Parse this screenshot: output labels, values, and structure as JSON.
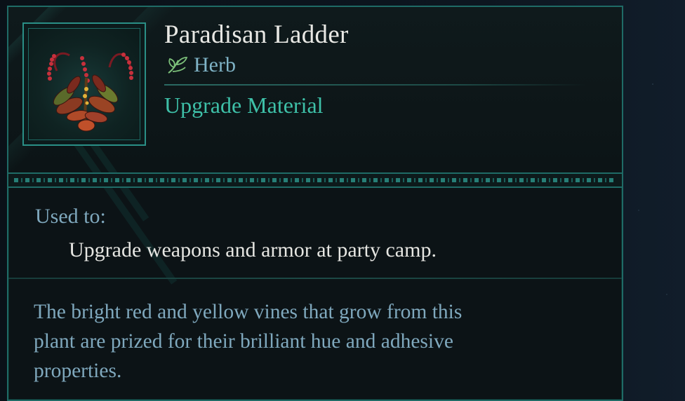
{
  "item": {
    "name": "Paradisan Ladder",
    "type": "Herb",
    "type_icon": "leaf-icon",
    "category": "Upgrade Material",
    "image": "paradisan-ladder-plant-icon"
  },
  "usage": {
    "label": "Used to:",
    "text": "Upgrade weapons and armor at party camp."
  },
  "description": {
    "line1": "The bright red and yellow vines that grow from this",
    "line2": "plant are prized for their brilliant hue and adhesive",
    "line3": "properties."
  },
  "colors": {
    "accent": "#2a8f86",
    "category": "#3ec0a8",
    "muted_text": "#7fa8bd",
    "title": "#e8e8e4"
  }
}
